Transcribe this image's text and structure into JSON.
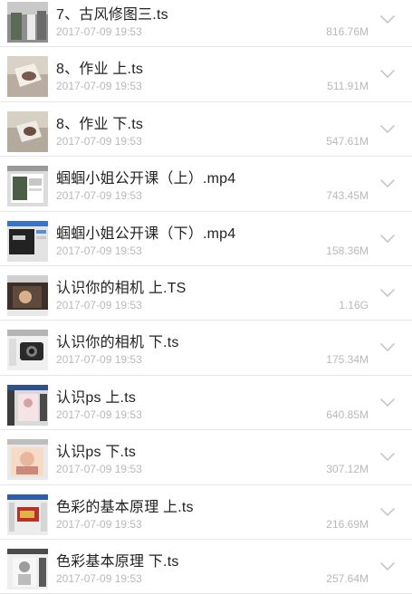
{
  "files": [
    {
      "name": "7、古风修图三.ts",
      "date": "2017-07-09 19:53",
      "size": "816.76M",
      "thumb_icon": "video-thumbnail-icon"
    },
    {
      "name": "8、作业 上.ts",
      "date": "2017-07-09 19:53",
      "size": "511.91M",
      "thumb_icon": "video-thumbnail-icon"
    },
    {
      "name": "8、作业 下.ts",
      "date": "2017-07-09 19:53",
      "size": "547.61M",
      "thumb_icon": "video-thumbnail-icon"
    },
    {
      "name": "蝈蝈小姐公开课（上）.mp4",
      "date": "2017-07-09 19:53",
      "size": "743.45M",
      "thumb_icon": "video-thumbnail-icon"
    },
    {
      "name": "蝈蝈小姐公开课（下）.mp4",
      "date": "2017-07-09 19:53",
      "size": "158.36M",
      "thumb_icon": "video-thumbnail-icon"
    },
    {
      "name": "认识你的相机 上.TS",
      "date": "2017-07-09 19:53",
      "size": "1.16G",
      "thumb_icon": "video-thumbnail-icon"
    },
    {
      "name": "认识你的相机 下.ts",
      "date": "2017-07-09 19:53",
      "size": "175.34M",
      "thumb_icon": "video-thumbnail-icon"
    },
    {
      "name": "认识ps 上.ts",
      "date": "2017-07-09 19:53",
      "size": "640.85M",
      "thumb_icon": "video-thumbnail-icon"
    },
    {
      "name": "认识ps 下.ts",
      "date": "2017-07-09 19:53",
      "size": "307.12M",
      "thumb_icon": "video-thumbnail-icon"
    },
    {
      "name": "色彩的基本原理 上.ts",
      "date": "2017-07-09 19:53",
      "size": "216.69M",
      "thumb_icon": "video-thumbnail-icon"
    },
    {
      "name": "色彩基本原理 下.ts",
      "date": "2017-07-09 19:53",
      "size": "257.64M",
      "thumb_icon": "video-thumbnail-icon"
    }
  ],
  "colors": {
    "name_text": "#222222",
    "meta_text": "#b9b9b9",
    "divider": "#e6e6e6",
    "chevron": "#c8c8c8"
  },
  "row_action_icon": "chevron-down-icon"
}
